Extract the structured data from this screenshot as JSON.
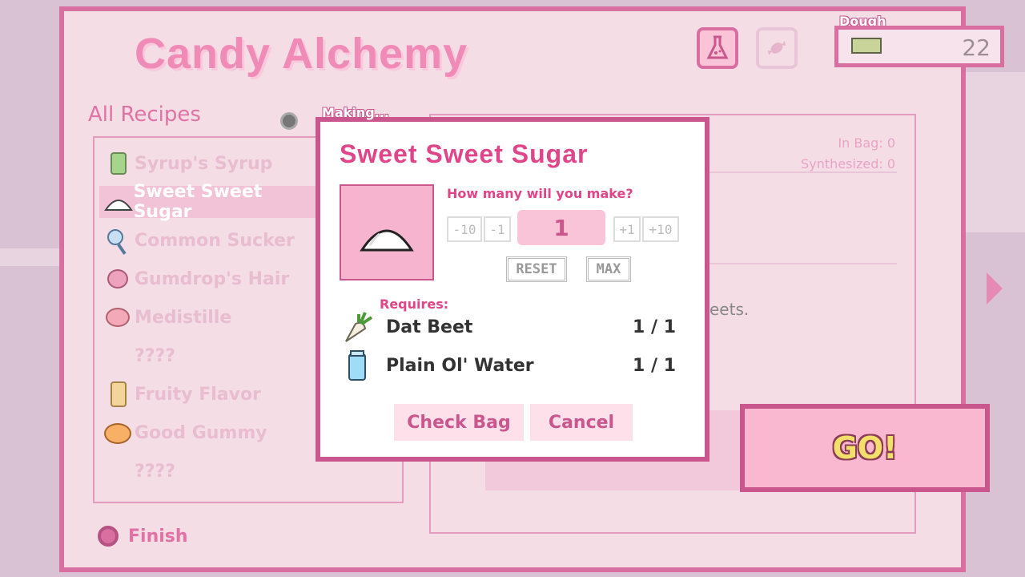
{
  "header": {
    "title": "Candy Alchemy"
  },
  "dough": {
    "label": "Dough",
    "value": "22"
  },
  "recipes": {
    "heading": "All Recipes",
    "items": [
      {
        "label": "Syrup's Syrup",
        "icon": "syrup-bottle-icon"
      },
      {
        "label": "Sweet Sweet Sugar",
        "icon": "sugar-pile-icon",
        "selected": true
      },
      {
        "label": "Common Sucker",
        "icon": "lollipop-icon"
      },
      {
        "label": "Gumdrop's Hair",
        "icon": "candy-floss-icon"
      },
      {
        "label": "Medistille",
        "icon": "pink-candy-icon"
      },
      {
        "label": "????",
        "icon": ""
      },
      {
        "label": "Fruity Flavor",
        "icon": "flavor-bottle-icon"
      },
      {
        "label": "Good Gummy",
        "icon": "orange-gummy-icon"
      },
      {
        "label": "????",
        "icon": ""
      }
    ]
  },
  "details": {
    "in_bag": "In Bag: 0",
    "synthesized": "Synthesized: 0",
    "desc_fragment": "eets."
  },
  "finish": {
    "label": "Finish"
  },
  "go": {
    "label": "GO!"
  },
  "modal": {
    "making_label": "Making...",
    "title": "Sweet Sweet Sugar",
    "prompt": "How many will you make?",
    "quantity": "1",
    "minus10": "-10",
    "minus1": "-1",
    "plus1": "+1",
    "plus10": "+10",
    "reset": "RESET",
    "max": "MAX",
    "requires_label": "Requires:",
    "requirements": [
      {
        "name": "Dat Beet",
        "count": "1 / 1",
        "icon": "beet-icon"
      },
      {
        "name": "Plain Ol' Water",
        "count": "1 / 1",
        "icon": "water-jar-icon"
      }
    ],
    "check_bag": "Check Bag",
    "cancel": "Cancel"
  },
  "colors": {
    "accent": "#c9578d",
    "panel": "#f5dde6",
    "title": "#ef8bb6"
  }
}
